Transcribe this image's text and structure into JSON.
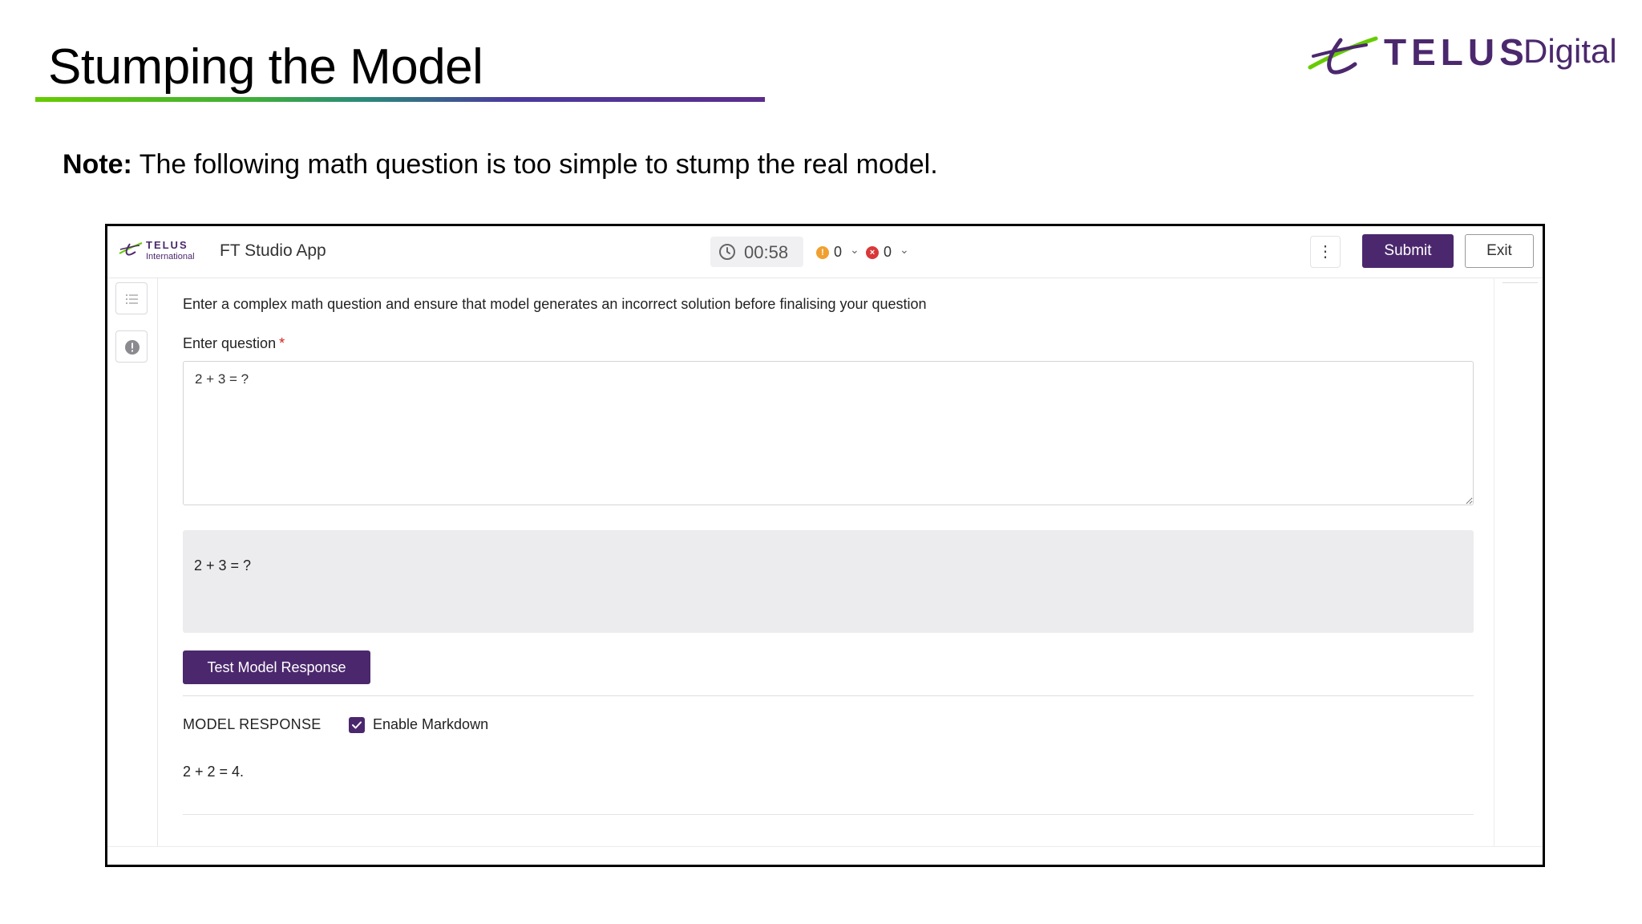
{
  "slide": {
    "title": "Stumping the Model",
    "note_label": "Note:",
    "note_text": " The following math question is too simple to stump the real model."
  },
  "brand": {
    "telus": "TELUS",
    "digital": "Digital",
    "accent": "#4b286d",
    "leaf": "#66cc00"
  },
  "app": {
    "logo_name": "TELUS",
    "logo_sub": "International",
    "name": "FT Studio App",
    "timer": "00:58",
    "warning_count": "0",
    "error_count": "0",
    "kebab": "⋮",
    "submit_label": "Submit",
    "exit_label": "Exit"
  },
  "task": {
    "instructions": "Enter a complex math question and ensure that model generates an incorrect solution before finalising your question",
    "question_label": "Enter question",
    "required_mark": "*",
    "question_value": "2 + 3 = ?",
    "preview_text": "2 + 3 = ?",
    "test_button_label": "Test Model Response",
    "response_header": "MODEL RESPONSE",
    "markdown_label": "Enable Markdown",
    "markdown_enabled": true,
    "response_text": "2 + 2 = 4."
  },
  "icons": [
    "list-icon",
    "info-icon",
    "clock-icon",
    "warning-icon",
    "error-icon",
    "chevron-down-icon",
    "check-icon"
  ]
}
